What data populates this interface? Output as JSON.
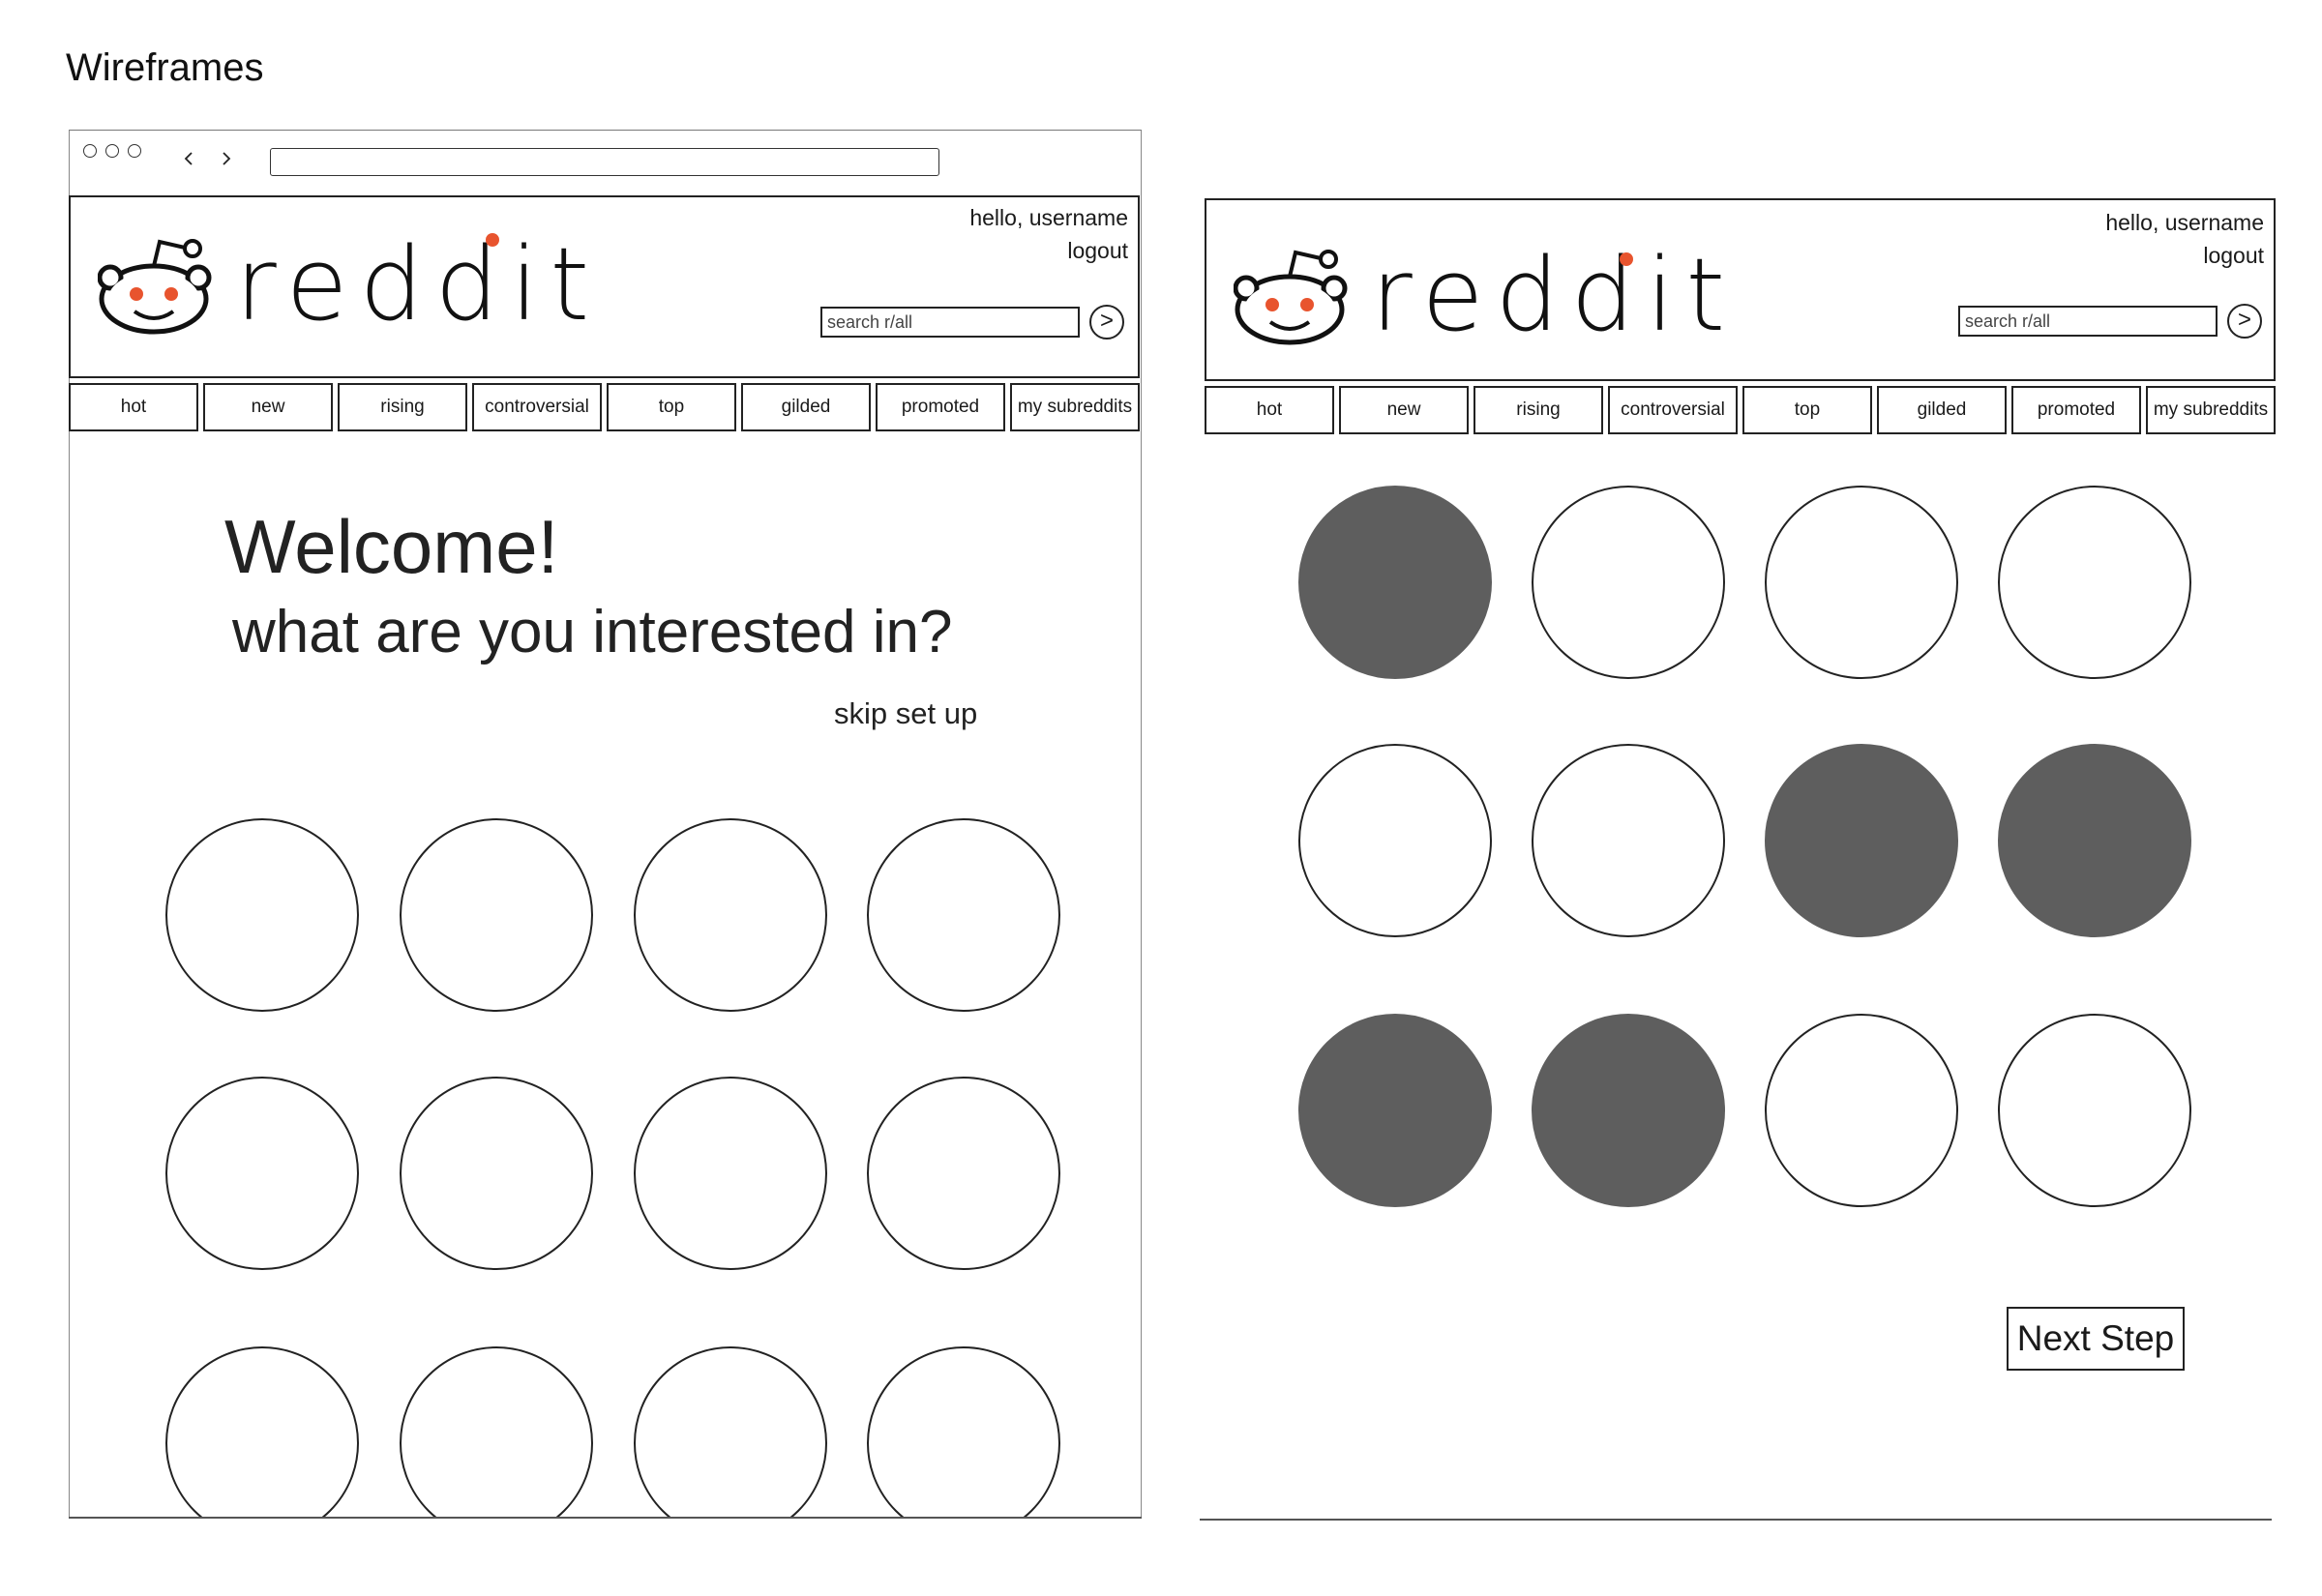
{
  "page_title": "Wireframes",
  "colors": {
    "accent": "#e8542e",
    "selected_circle": "#5e5e5e",
    "stroke": "#222222"
  },
  "left": {
    "header": {
      "logo_text": "reddit",
      "greeting": "hello, username",
      "logout": "logout",
      "search_placeholder": "search r/all",
      "go_label": ">"
    },
    "tabs": [
      "hot",
      "new",
      "rising",
      "controversial",
      "top",
      "gilded",
      "promoted",
      "my subreddits"
    ],
    "welcome": "Welcome!",
    "question": "what are you interested in?",
    "skip": "skip set up",
    "circles_selected": [
      false,
      false,
      false,
      false,
      false,
      false,
      false,
      false,
      false,
      false,
      false,
      false
    ]
  },
  "right": {
    "header": {
      "logo_text": "reddit",
      "greeting": "hello, username",
      "logout": "logout",
      "search_placeholder": "search r/all",
      "go_label": ">"
    },
    "tabs": [
      "hot",
      "new",
      "rising",
      "controversial",
      "top",
      "gilded",
      "promoted",
      "my subreddits"
    ],
    "circles_selected": [
      true,
      false,
      false,
      false,
      false,
      false,
      true,
      true,
      true,
      true,
      false,
      false
    ],
    "next_step": "Next Step"
  }
}
